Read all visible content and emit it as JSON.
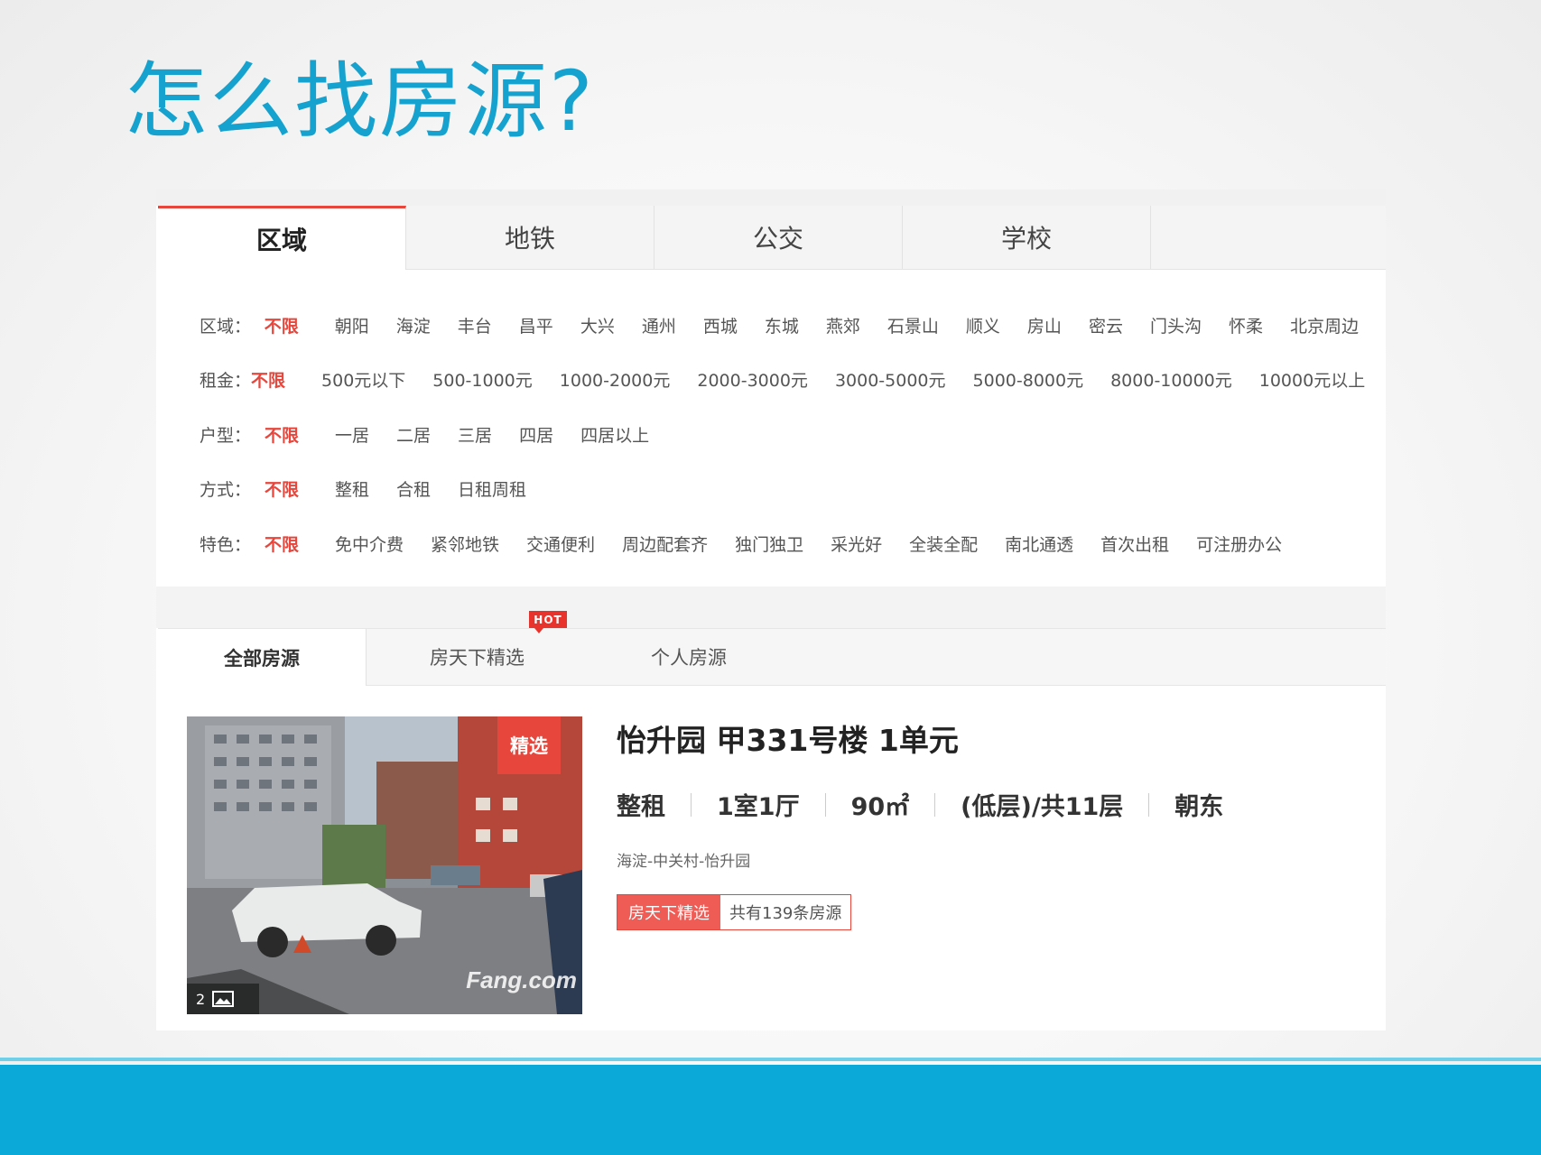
{
  "slide": {
    "title": "怎么找房源?"
  },
  "search_tabs": [
    "区域",
    "地铁",
    "公交",
    "学校"
  ],
  "filters": [
    {
      "label": "区域：",
      "selected": "不限",
      "options": [
        "朝阳",
        "海淀",
        "丰台",
        "昌平",
        "大兴",
        "通州",
        "西城",
        "东城",
        "燕郊",
        "石景山",
        "顺义",
        "房山",
        "密云",
        "门头沟",
        "怀柔",
        "北京周边"
      ]
    },
    {
      "label": "租金：",
      "selected": "不限",
      "options": [
        "500元以下",
        "500-1000元",
        "1000-2000元",
        "2000-3000元",
        "3000-5000元",
        "5000-8000元",
        "8000-10000元",
        "10000元以上"
      ]
    },
    {
      "label": "户型：",
      "selected": "不限",
      "options": [
        "一居",
        "二居",
        "三居",
        "四居",
        "四居以上"
      ]
    },
    {
      "label": "方式：",
      "selected": "不限",
      "options": [
        "整租",
        "合租",
        "日租周租"
      ]
    },
    {
      "label": "特色：",
      "selected": "不限",
      "options": [
        "免中介费",
        "紧邻地铁",
        "交通便利",
        "周边配套齐",
        "独门独卫",
        "采光好",
        "全装全配",
        "南北通透",
        "首次出租",
        "可注册办公"
      ]
    }
  ],
  "list_tabs": {
    "all": "全部房源",
    "featured": "房天下精选",
    "personal": "个人房源",
    "hot_badge": "HOT"
  },
  "listing": {
    "title": "怡升园 甲331号楼 1单元",
    "specs": [
      "整租",
      "1室1厅",
      "90㎡",
      "(低层)/共11层",
      "朝东"
    ],
    "address": "海淀-中关村-怡升园",
    "tag_featured": "房天下精选",
    "tag_count": "共有139条房源",
    "photo_badge": "精选",
    "photo_count": "2",
    "photo_watermark": "Fang.com"
  },
  "colors": {
    "title_blue": "#16a2cf",
    "accent_red": "#e7463c",
    "band_blue": "#0aa9d8"
  }
}
